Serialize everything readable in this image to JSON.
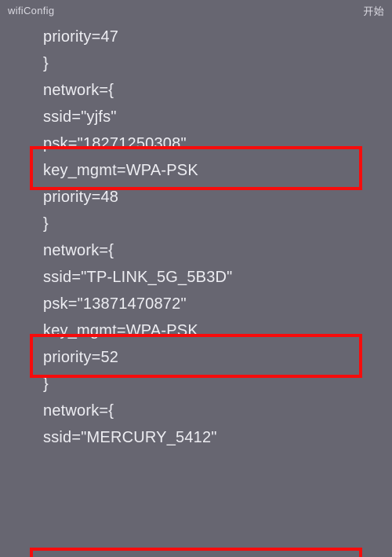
{
  "header": {
    "title": "wifiConfig",
    "action": "开始"
  },
  "lines": [
    "priority=47",
    "}",
    "network={",
    "ssid=\"yjfs\"",
    "psk=\"18271250308\"",
    "key_mgmt=WPA-PSK",
    "priority=48",
    "}",
    "network={",
    "ssid=\"TP-LINK_5G_5B3D\"",
    "psk=\"13871470872\"",
    "key_mgmt=WPA-PSK",
    "priority=52",
    "}",
    "network={",
    "ssid=\"MERCURY_5412\""
  ],
  "highlights": {
    "box1": "psk-highlight-1",
    "box2": "psk-highlight-2",
    "box3": "psk-highlight-3"
  }
}
